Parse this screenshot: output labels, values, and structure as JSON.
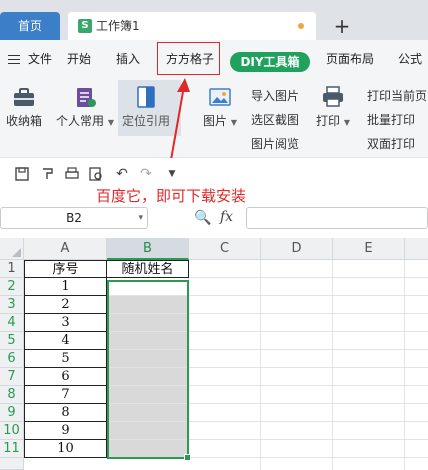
{
  "tabs": {
    "home": "首页",
    "doc_title": "工作簿1",
    "doc_icon_letter": "S",
    "new_tab": "+"
  },
  "menu": {
    "file": "文件",
    "start": "开始",
    "insert": "插入",
    "fangfang": "方方格子",
    "diy": "DIY工具箱",
    "page_layout": "页面布局",
    "formula": "公式"
  },
  "ribbon": {
    "toolbox": "收纳箱",
    "personal": "个人常用",
    "locate": "定位引用",
    "picture": "图片",
    "import_picture": "导入图片",
    "region_screenshot": "选区截图",
    "picture_view": "图片阅览",
    "print": "打印",
    "print_current_page": "打印当前页",
    "batch_print": "批量打印",
    "duplex_print": "双面打印"
  },
  "hint": "百度它，即可下载安装",
  "formula_bar": {
    "name_box": "B2",
    "fx": "fx"
  },
  "columns": [
    "A",
    "B",
    "C",
    "D",
    "E"
  ],
  "rows": [
    "1",
    "2",
    "3",
    "4",
    "5",
    "6",
    "7",
    "8",
    "9",
    "10",
    "11"
  ],
  "cells": {
    "A1": "序号",
    "B1": "随机姓名",
    "A": [
      "1",
      "2",
      "3",
      "4",
      "5",
      "6",
      "7",
      "8",
      "9",
      "10"
    ]
  },
  "colors": {
    "accent_green": "#2a9a54",
    "annotation_red": "#e0282a",
    "home_tab_blue": "#3d7ec9"
  }
}
